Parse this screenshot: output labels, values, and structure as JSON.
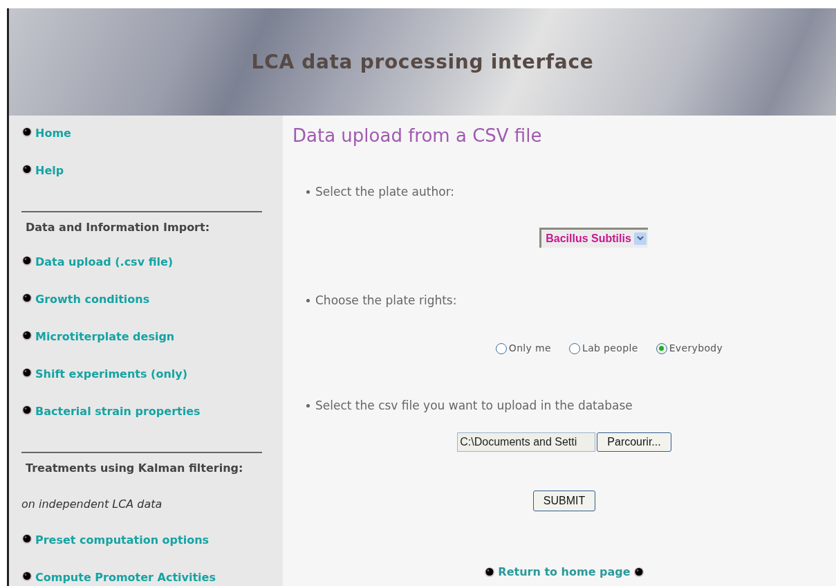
{
  "header": {
    "title": "LCA data processing interface"
  },
  "sidebar": {
    "items": [
      {
        "kind": "link",
        "label": "Home"
      },
      {
        "kind": "link",
        "label": "Help"
      },
      {
        "kind": "divider"
      },
      {
        "kind": "heading",
        "label": "Data and Information Import:"
      },
      {
        "kind": "link",
        "label": "Data upload (.csv file)"
      },
      {
        "kind": "link",
        "label": "Growth conditions"
      },
      {
        "kind": "link",
        "label": "Microtiterplate design"
      },
      {
        "kind": "link",
        "label": "Shift experiments (only)"
      },
      {
        "kind": "link",
        "label": "Bacterial strain properties"
      },
      {
        "kind": "divider"
      },
      {
        "kind": "heading",
        "label": "Treatments using Kalman filtering:"
      },
      {
        "kind": "note",
        "label": "on independent LCA data"
      },
      {
        "kind": "link",
        "label": "Preset computation options"
      },
      {
        "kind": "link",
        "label": "Compute Promoter Activities"
      }
    ]
  },
  "main": {
    "title": "Data upload from a CSV file",
    "author": {
      "prompt": "Select the plate author:",
      "value": "Bacillus Subtilis"
    },
    "rights": {
      "prompt": "Choose the plate rights:",
      "options": [
        {
          "label": "Only me",
          "selected": false
        },
        {
          "label": "Lab people",
          "selected": false
        },
        {
          "label": "Everybody",
          "selected": true
        }
      ]
    },
    "file": {
      "prompt": "Select the csv file you want to upload in the database",
      "value": "C:\\Documents and Setti",
      "browse_label": "Parcourir..."
    },
    "submit_label": "SUBMIT",
    "return_link": "Return to home page"
  }
}
